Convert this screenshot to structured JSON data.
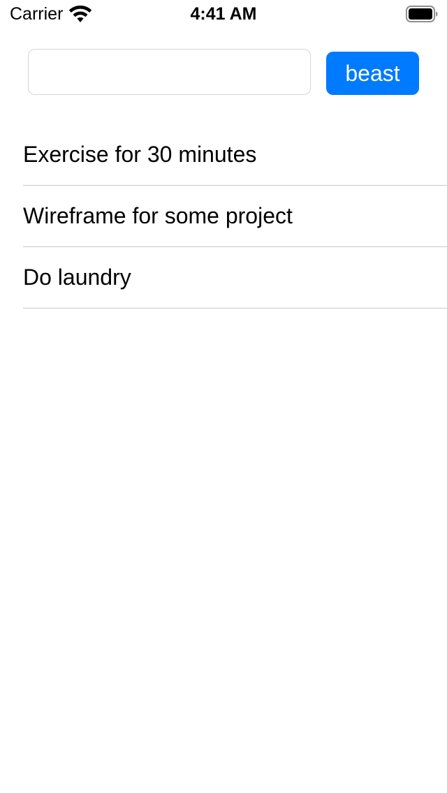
{
  "status_bar": {
    "carrier": "Carrier",
    "time": "4:41 AM",
    "wifi_icon": "wifi-icon",
    "battery_icon": "battery-icon"
  },
  "input_row": {
    "field_value": "",
    "field_placeholder": "",
    "button_label": "beast"
  },
  "tasks": [
    {
      "label": "Exercise for 30 minutes"
    },
    {
      "label": "Wireframe for some project"
    },
    {
      "label": "Do laundry"
    }
  ],
  "colors": {
    "accent": "#007aff",
    "divider": "#c8c7cc",
    "field_border": "#d4d4d8"
  }
}
